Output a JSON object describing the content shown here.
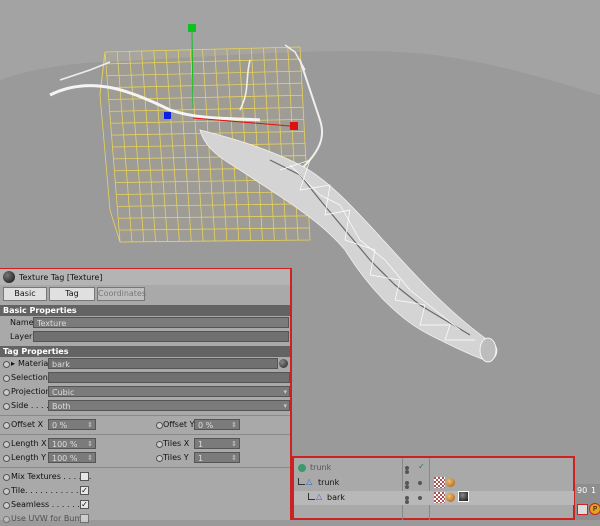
{
  "texture_tag": {
    "title": "Texture Tag [Texture]",
    "tabs": [
      "Basic",
      "Tag",
      "Coordinates"
    ],
    "basic_section": "Basic Properties",
    "name_label": "Name",
    "name_value": "Texture",
    "layer_label": "Layer",
    "tag_section": "Tag Properties",
    "material_label": "Material",
    "material_value": "bark",
    "selection_label": "Selection",
    "projection_label": "Projection",
    "projection_value": "Cubic",
    "side_label": "Side . . . . .",
    "side_value": "Both",
    "offset_x_label": "Offset X",
    "offset_x_value": "0 %",
    "offset_y_label": "Offset Y",
    "offset_y_value": "0 %",
    "length_x_label": "Length X",
    "length_x_value": "100 %",
    "length_y_label": "Length Y",
    "length_y_value": "100 %",
    "tiles_x_label": "Tiles X",
    "tiles_x_value": "1",
    "tiles_y_label": "Tiles Y",
    "tiles_y_value": "1",
    "mix_label": "Mix Textures . . . . . .",
    "mix_checked": false,
    "tile_label": "Tile. . . . . . . . . . . . .",
    "tile_checked": true,
    "seamless_label": "Seamless . . . . . . .",
    "seamless_checked": true,
    "uvw_label": "Use UVW for Bump"
  },
  "objects": {
    "rows": [
      {
        "name": "trunk"
      },
      {
        "name": "trunk"
      },
      {
        "name": "bark"
      }
    ],
    "side_numbers": [
      "90",
      "1"
    ]
  },
  "colors": {
    "panel_border": "#cc2222",
    "viewport_floor": "#9a9a9a",
    "viewport_sky": "#a2a2a2",
    "bounding_box": "#e7d35a",
    "axis_x": "#e01010",
    "axis_y": "#10c020",
    "axis_z": "#1020e0"
  }
}
